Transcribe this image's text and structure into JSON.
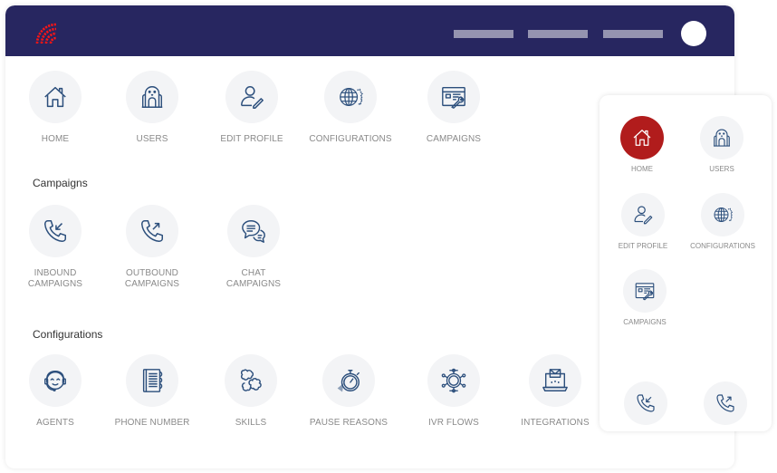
{
  "colors": {
    "topbar": "#272660",
    "accent": "#b11c1c",
    "icon_stroke": "#2c4f7c",
    "circle_bg": "#f3f4f6",
    "label": "#8a8a8a"
  },
  "header": {
    "logo_icon": "radar-logo-icon",
    "nav_placeholders": 3,
    "avatar": "user-avatar"
  },
  "main": {
    "top_tiles": [
      {
        "label": "HOME",
        "icon": "home-icon"
      },
      {
        "label": "USERS",
        "icon": "users-icon"
      },
      {
        "label": "EDIT PROFILE",
        "icon": "edit-profile-icon"
      },
      {
        "label": "CONFIGURATIONS",
        "icon": "globe-gear-icon"
      },
      {
        "label": "CAMPAIGNS",
        "icon": "campaign-tools-icon"
      }
    ],
    "campaigns_section": {
      "title": "Campaigns",
      "tiles": [
        {
          "label": "INBOUND\nCAMPAIGNS",
          "icon": "inbound-call-icon"
        },
        {
          "label": "OUTBOUND\nCAMPAIGNS",
          "icon": "outbound-call-icon"
        },
        {
          "label": "CHAT\nCAMPAIGNS",
          "icon": "chat-bubbles-icon"
        }
      ]
    },
    "configurations_section": {
      "title": "Configurations",
      "tiles": [
        {
          "label": "AGENTS",
          "icon": "agent-headset-icon"
        },
        {
          "label": "PHONE NUMBER",
          "icon": "phone-book-icon"
        },
        {
          "label": "SKILLS",
          "icon": "skills-puzzle-icon"
        },
        {
          "label": "PAUSE REASONS",
          "icon": "stopwatch-icon"
        },
        {
          "label": "IVR FLOWS",
          "icon": "ivr-flow-icon"
        },
        {
          "label": "INTEGRATIONS",
          "icon": "laptop-mail-icon"
        }
      ]
    }
  },
  "side_panel": {
    "tiles": [
      {
        "label": "HOME",
        "icon": "home-icon",
        "active": true
      },
      {
        "label": "USERS",
        "icon": "users-icon"
      },
      {
        "label": "EDIT PROFILE",
        "icon": "edit-profile-icon"
      },
      {
        "label": "CONFIGURATIONS",
        "icon": "globe-gear-icon"
      },
      {
        "label": "CAMPAIGNS",
        "icon": "campaign-tools-icon"
      },
      {
        "label": "",
        "icon": "inbound-call-icon"
      },
      {
        "label": "",
        "icon": "outbound-call-icon"
      }
    ]
  }
}
